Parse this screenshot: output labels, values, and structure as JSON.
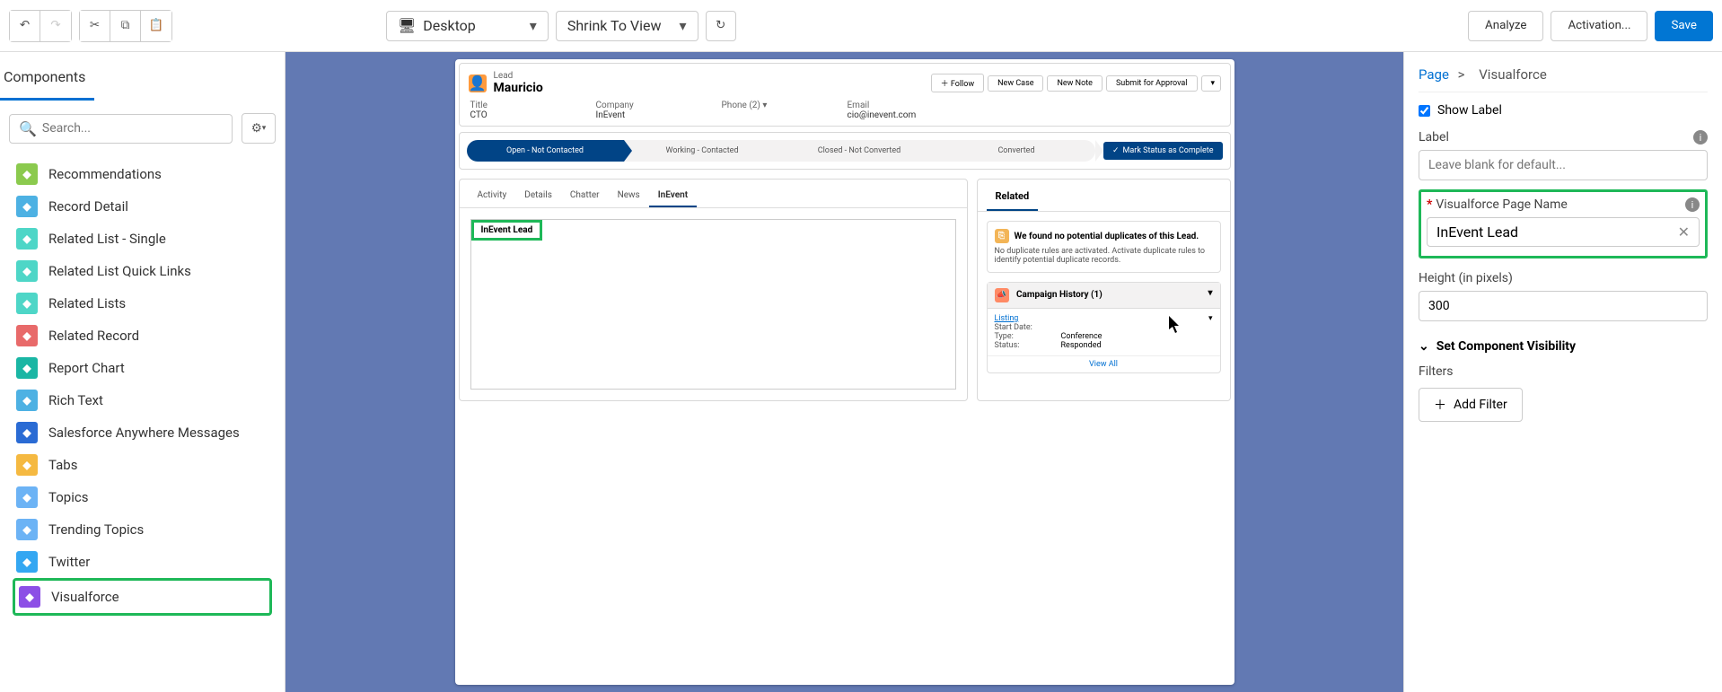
{
  "toolbar": {
    "desktop_label": "Desktop",
    "shrink_label": "Shrink To View",
    "analyze_label": "Analyze",
    "activation_label": "Activation...",
    "save_label": "Save"
  },
  "sidebar": {
    "tab": "Components",
    "search_placeholder": "Search...",
    "items": [
      {
        "label": "Recommendations",
        "color": "#8bca4e"
      },
      {
        "label": "Record Detail",
        "color": "#4db1e3"
      },
      {
        "label": "Related List - Single",
        "color": "#4ed6c7"
      },
      {
        "label": "Related List Quick Links",
        "color": "#4ed6c7"
      },
      {
        "label": "Related Lists",
        "color": "#4ed6c7"
      },
      {
        "label": "Related Record",
        "color": "#e86a6a"
      },
      {
        "label": "Report Chart",
        "color": "#1ab6a4"
      },
      {
        "label": "Rich Text",
        "color": "#4db1e3"
      },
      {
        "label": "Salesforce Anywhere Messages",
        "color": "#2a6bd4"
      },
      {
        "label": "Tabs",
        "color": "#f5b941"
      },
      {
        "label": "Topics",
        "color": "#6cb3f5"
      },
      {
        "label": "Trending Topics",
        "color": "#6cb3f5"
      },
      {
        "label": "Twitter",
        "color": "#34a7f2"
      },
      {
        "label": "Visualforce",
        "color": "#8c4fe6",
        "hl": true
      }
    ]
  },
  "canvas": {
    "record": {
      "obj_label": "Lead",
      "name": "Mauricio",
      "follow_label": "Follow",
      "new_case_label": "New Case",
      "new_note_label": "New Note",
      "submit_label": "Submit for Approval",
      "fields": {
        "title_lbl": "Title",
        "title_val": "CTO",
        "company_lbl": "Company",
        "company_val": "InEvent",
        "phone_lbl": "Phone (2)",
        "email_lbl": "Email",
        "email_val": "cio@inevent.com"
      }
    },
    "path": {
      "s1": "Open - Not Contacted",
      "s2": "Working - Contacted",
      "s3": "Closed - Not Converted",
      "s4": "Converted",
      "complete": "Mark Status as Complete"
    },
    "tabs": {
      "activity": "Activity",
      "details": "Details",
      "chatter": "Chatter",
      "news": "News",
      "inevent": "InEvent"
    },
    "vf_badge": "InEvent Lead",
    "related": {
      "header": "Related",
      "dup_title": "We found no potential duplicates of this Lead.",
      "dup_body": "No duplicate rules are activated. Activate duplicate rules to identify potential duplicate records.",
      "camp_title": "Campaign History (1)",
      "listing": "Listing",
      "start_date": "Start Date:",
      "type_lbl": "Type:",
      "type_val": "Conference",
      "status_lbl": "Status:",
      "status_val": "Responded",
      "view_all": "View All"
    }
  },
  "right": {
    "crumb_page": "Page",
    "crumb_current": "Visualforce",
    "show_label": "Show Label",
    "label_label": "Label",
    "label_placeholder": "Leave blank for default...",
    "vf_name_label": "Visualforce Page Name",
    "vf_name_value": "InEvent Lead",
    "height_label": "Height (in pixels)",
    "height_value": "300",
    "section": "Set Component Visibility",
    "filters": "Filters",
    "add_filter": "Add Filter"
  }
}
